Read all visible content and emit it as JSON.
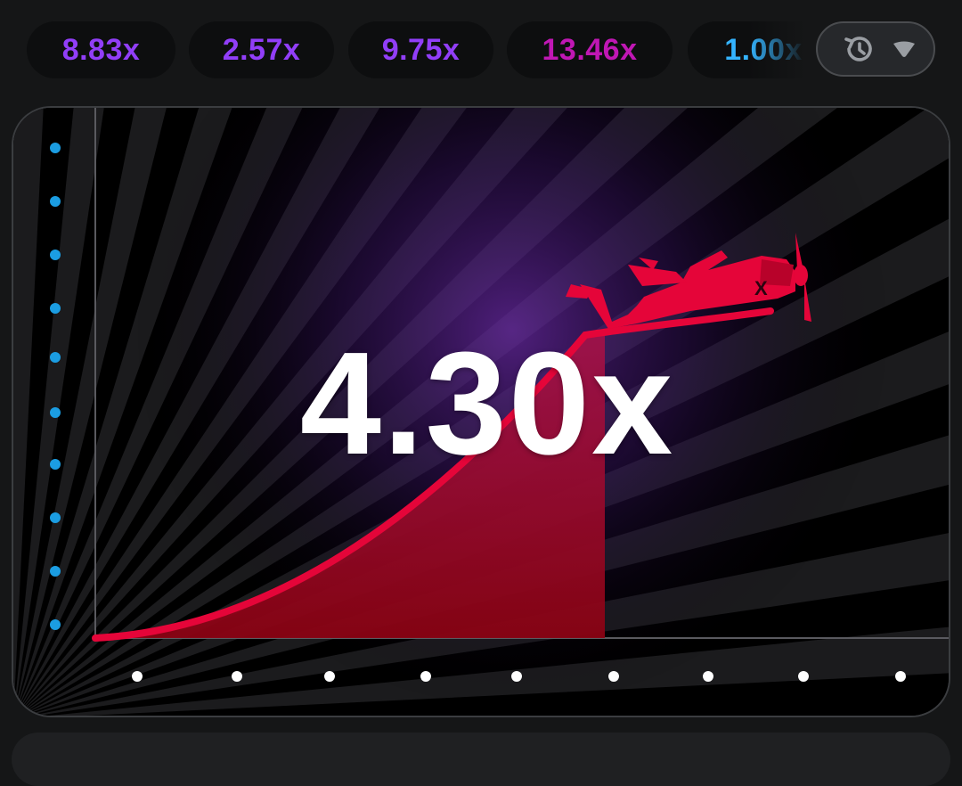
{
  "history": {
    "items": [
      {
        "label": "8.83x",
        "color": "#913ef8"
      },
      {
        "label": "2.57x",
        "color": "#913ef8"
      },
      {
        "label": "9.75x",
        "color": "#913ef8"
      },
      {
        "label": "13.46x",
        "color": "#c017b4"
      },
      {
        "label": "1.00x",
        "color": "#34b4ff"
      }
    ],
    "toggle_icons": [
      "history-icon",
      "chevron-down-icon"
    ]
  },
  "game": {
    "multiplier": "4.30x",
    "curve_color": "#e50539",
    "dot_colors": {
      "y_axis": "#1b9de2",
      "x_axis": "#ffffff"
    }
  }
}
